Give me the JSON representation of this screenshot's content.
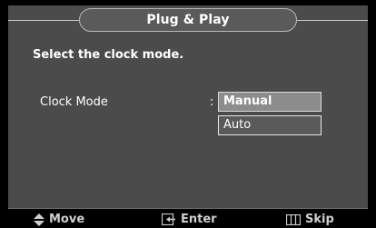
{
  "dialog": {
    "title": "Plug & Play",
    "prompt": "Select the clock mode."
  },
  "setting": {
    "label": "Clock Mode",
    "separator": ":",
    "options": [
      "Manual",
      "Auto"
    ],
    "selected": "Manual"
  },
  "footer": {
    "move_label": "Move",
    "enter_label": "Enter",
    "skip_label": "Skip"
  },
  "colors": {
    "panel": "#4b4b4b",
    "highlight": "#8c8c8c",
    "footer": "#000000"
  }
}
